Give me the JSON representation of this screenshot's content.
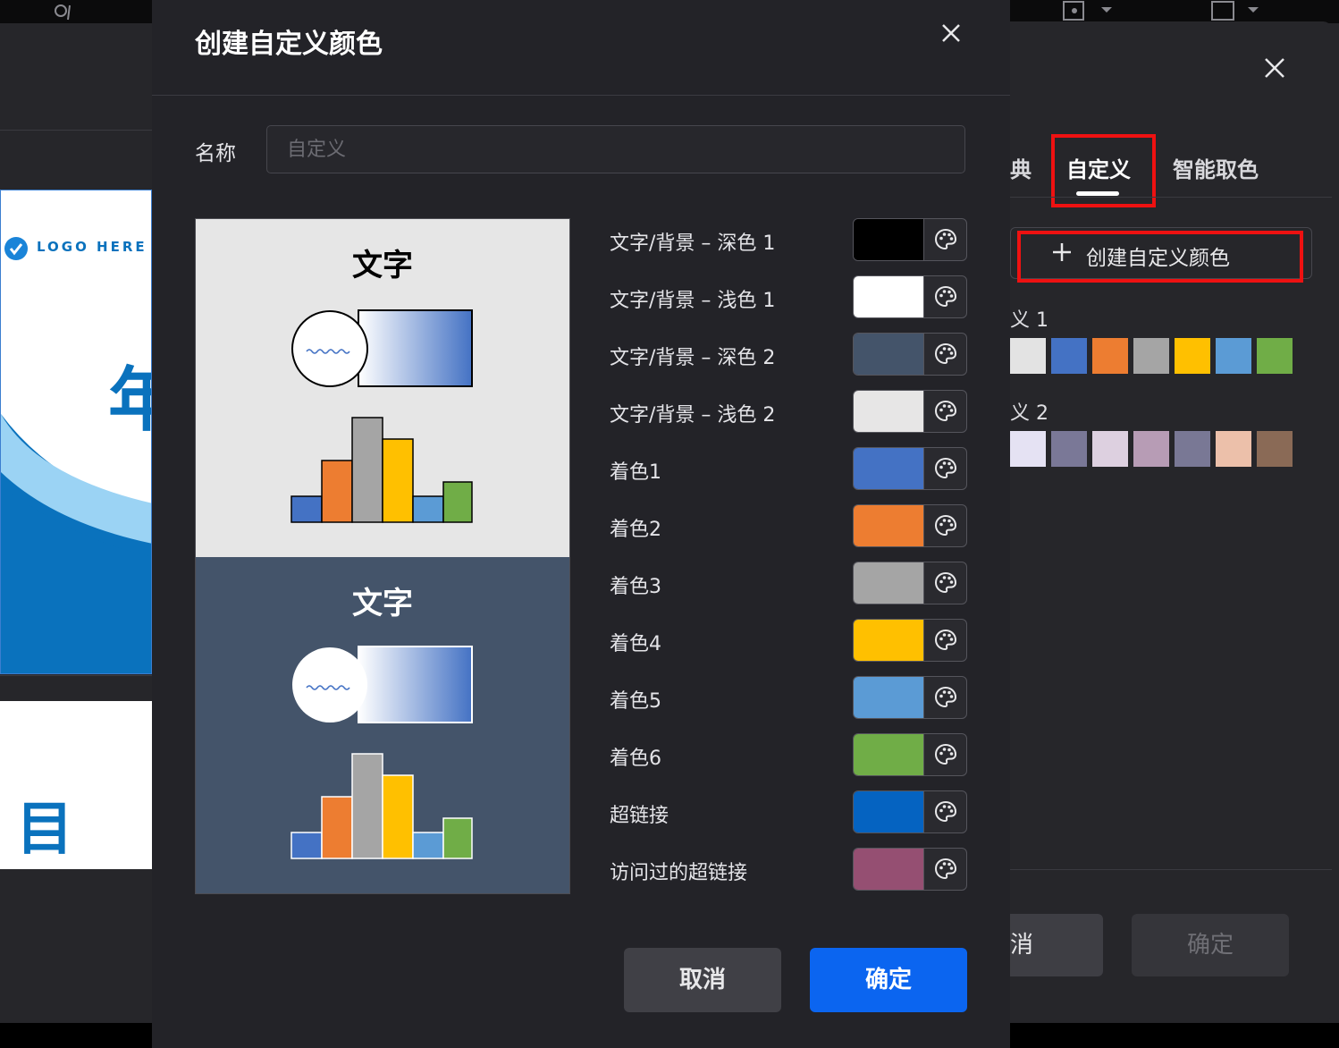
{
  "background": {
    "slide1": {
      "logo": "LOGO HERE",
      "partial_char": "年"
    },
    "slide2": {
      "text": "目 录"
    }
  },
  "right_panel": {
    "tabs": [
      {
        "label": "典"
      },
      {
        "label": "自定义"
      },
      {
        "label": "智能取色"
      }
    ],
    "create_label": "创建自定义颜色",
    "sets": [
      {
        "label": "义 1",
        "colors": [
          "#e3e3e3",
          "#4472c4",
          "#ed7d31",
          "#a5a5a5",
          "#ffc000",
          "#5b9bd5",
          "#70ad47"
        ]
      },
      {
        "label": "义 2",
        "colors": [
          "#e5e2f3",
          "#7a7897",
          "#ddd0e0",
          "#b79cb5",
          "#797895",
          "#ecc0aa",
          "#8a6a56"
        ]
      }
    ],
    "cancel_label": "取消",
    "ok_label": "确定"
  },
  "modal": {
    "title": "创建自定义颜色",
    "name_label": "名称",
    "name_placeholder": "自定义",
    "preview_text": "文字",
    "rows": [
      {
        "label": "文字/背景 – 深色 1",
        "color": "#000000"
      },
      {
        "label": "文字/背景 – 浅色 1",
        "color": "#ffffff"
      },
      {
        "label": "文字/背景 – 深色 2",
        "color": "#44546a"
      },
      {
        "label": "文字/背景 – 浅色 2",
        "color": "#e7e6e6"
      },
      {
        "label": "着色1",
        "color": "#4472c4"
      },
      {
        "label": "着色2",
        "color": "#ed7d31"
      },
      {
        "label": "着色3",
        "color": "#a5a5a5"
      },
      {
        "label": "着色4",
        "color": "#ffc000"
      },
      {
        "label": "着色5",
        "color": "#5b9bd5"
      },
      {
        "label": "着色6",
        "color": "#70ad47"
      },
      {
        "label": "超链接",
        "color": "#0563c1"
      },
      {
        "label": "访问过的超链接",
        "color": "#954f72"
      }
    ],
    "cancel_label": "取消",
    "ok_label": "确定"
  }
}
